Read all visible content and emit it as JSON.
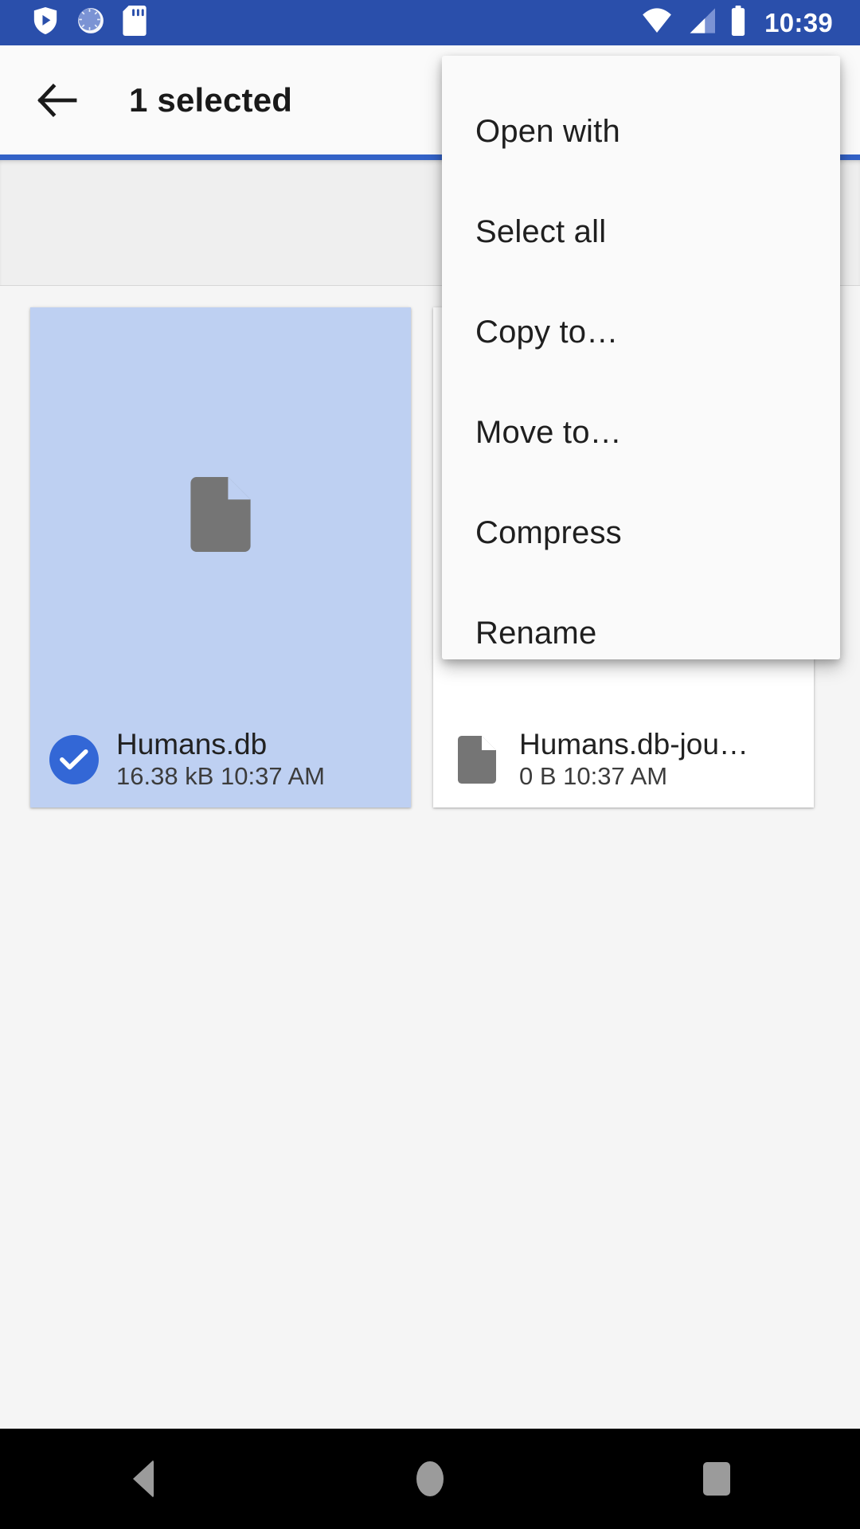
{
  "status_bar": {
    "background_color": "#2a4fab",
    "time": "10:39",
    "left_icons": [
      {
        "name": "play-protect-shield-icon",
        "label": "Play Protect"
      },
      {
        "name": "sync-clock-icon",
        "label": "Sync"
      },
      {
        "name": "sd-card-icon",
        "label": "SD card"
      }
    ],
    "right_icons": [
      {
        "name": "wifi-icon",
        "label": "Wi-Fi"
      },
      {
        "name": "cellular-signal-icon",
        "label": "Mobile signal"
      },
      {
        "name": "battery-icon",
        "label": "Battery"
      }
    ]
  },
  "app_bar": {
    "background_color": "#fafafa",
    "accent_color": "#3362c7",
    "back_icon": "arrow-left-icon",
    "title": "1 selected"
  },
  "path_bar": {
    "background_color": "#efefef",
    "text": ""
  },
  "files": [
    {
      "name": "Humans.db",
      "size": "16.38 kB",
      "time": "10:37 AM",
      "selected": true,
      "icon": "document-icon",
      "selected_background": "#bed0f2",
      "check_color": "#3367d6"
    },
    {
      "name": "Humans.db-jou…",
      "size": "0 B",
      "time": "10:37 AM",
      "selected": false,
      "icon": "document-icon",
      "selected_background": "#ffffff",
      "check_color": "#3367d6"
    }
  ],
  "popup_menu": {
    "background_color": "#fafafa",
    "items": [
      {
        "label": "Open with"
      },
      {
        "label": "Select all"
      },
      {
        "label": "Copy to…"
      },
      {
        "label": "Move to…"
      },
      {
        "label": "Compress"
      },
      {
        "label": "Rename"
      }
    ]
  },
  "nav_bar": {
    "background_color": "#000000",
    "buttons": [
      {
        "name": "nav-back-button",
        "label": "Back"
      },
      {
        "name": "nav-home-button",
        "label": "Home"
      },
      {
        "name": "nav-recents-button",
        "label": "Recents"
      }
    ]
  }
}
